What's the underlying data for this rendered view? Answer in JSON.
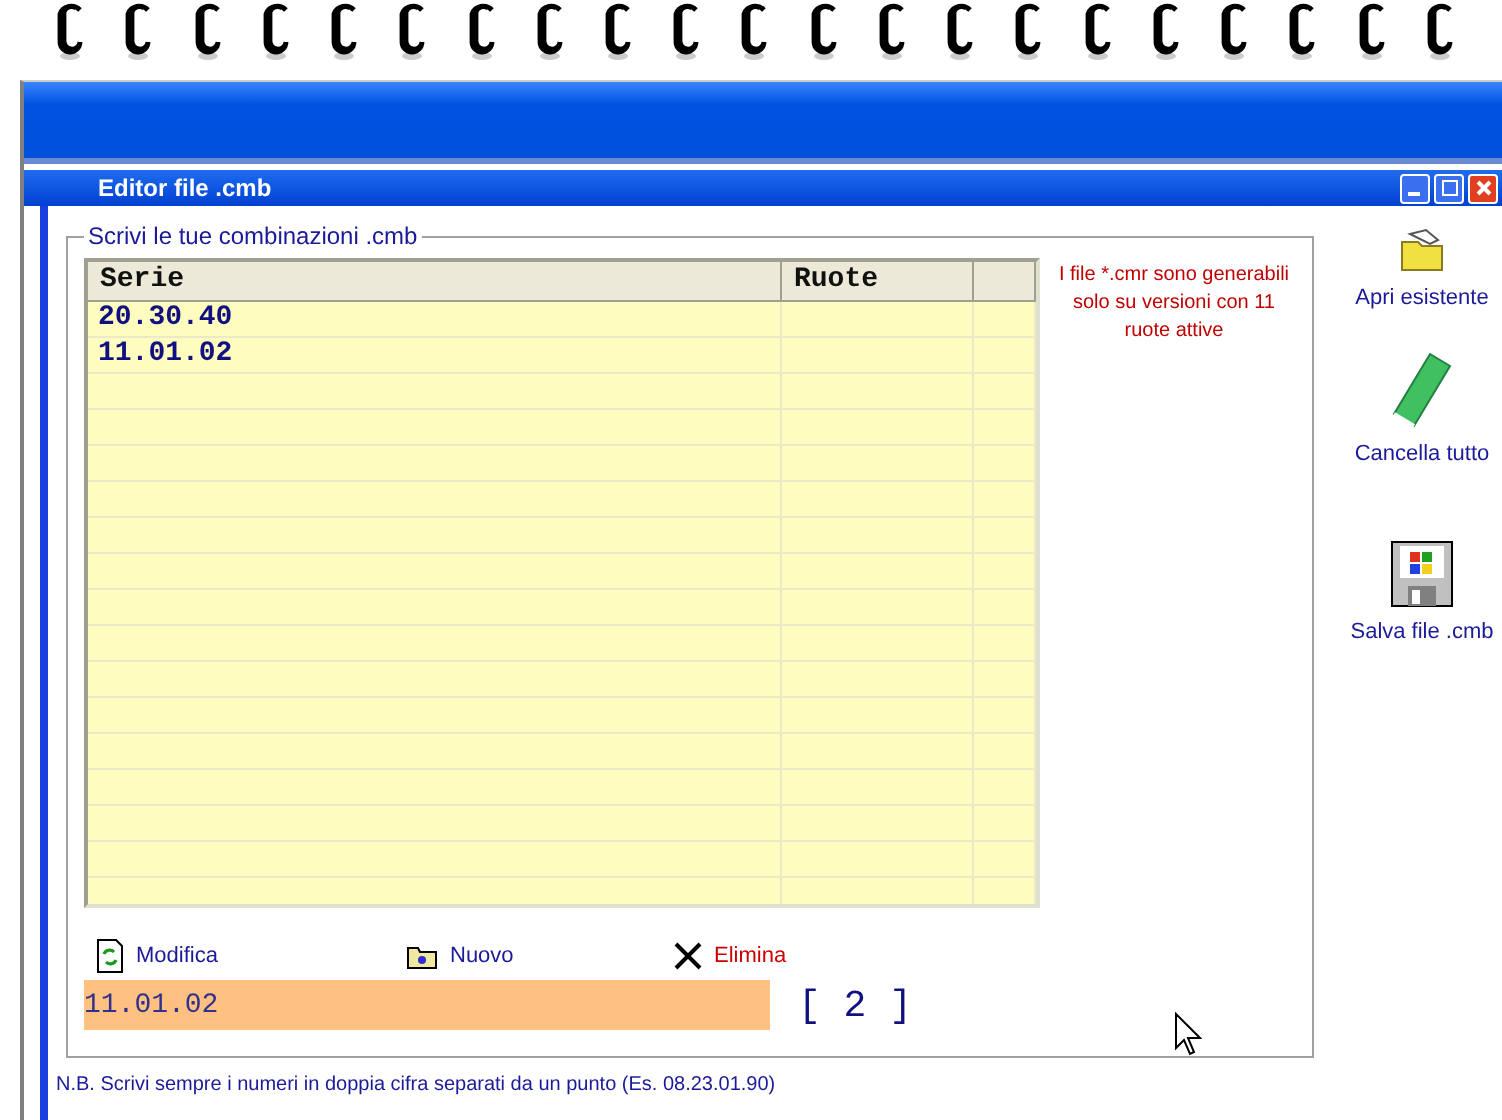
{
  "window": {
    "title": "Editor file .cmb"
  },
  "group": {
    "legend": "Scrivi le tue combinazioni .cmb"
  },
  "table": {
    "columns": [
      "Serie",
      "Ruote"
    ],
    "rows": [
      {
        "serie": "20.30.40",
        "ruote": ""
      },
      {
        "serie": "11.01.02",
        "ruote": ""
      }
    ]
  },
  "notice": "I file *.cmr sono generabili solo su versioni con 11 ruote attive",
  "actions": [
    {
      "kind": "edit",
      "label": "Modifica"
    },
    {
      "kind": "new",
      "label": "Nuovo"
    },
    {
      "kind": "delete",
      "label": "Elimina"
    }
  ],
  "entry": {
    "value": "11.01.02",
    "count": "[ 2 ]"
  },
  "side_buttons": [
    {
      "kind": "open",
      "label": "Apri esistente"
    },
    {
      "kind": "clear",
      "label": "Cancella tutto"
    },
    {
      "kind": "save",
      "label": "Salva file .cmb"
    }
  ],
  "footer_note": "N.B. Scrivi sempre i numeri in doppia cifra separati da un punto (Es. 08.23.01.90)"
}
